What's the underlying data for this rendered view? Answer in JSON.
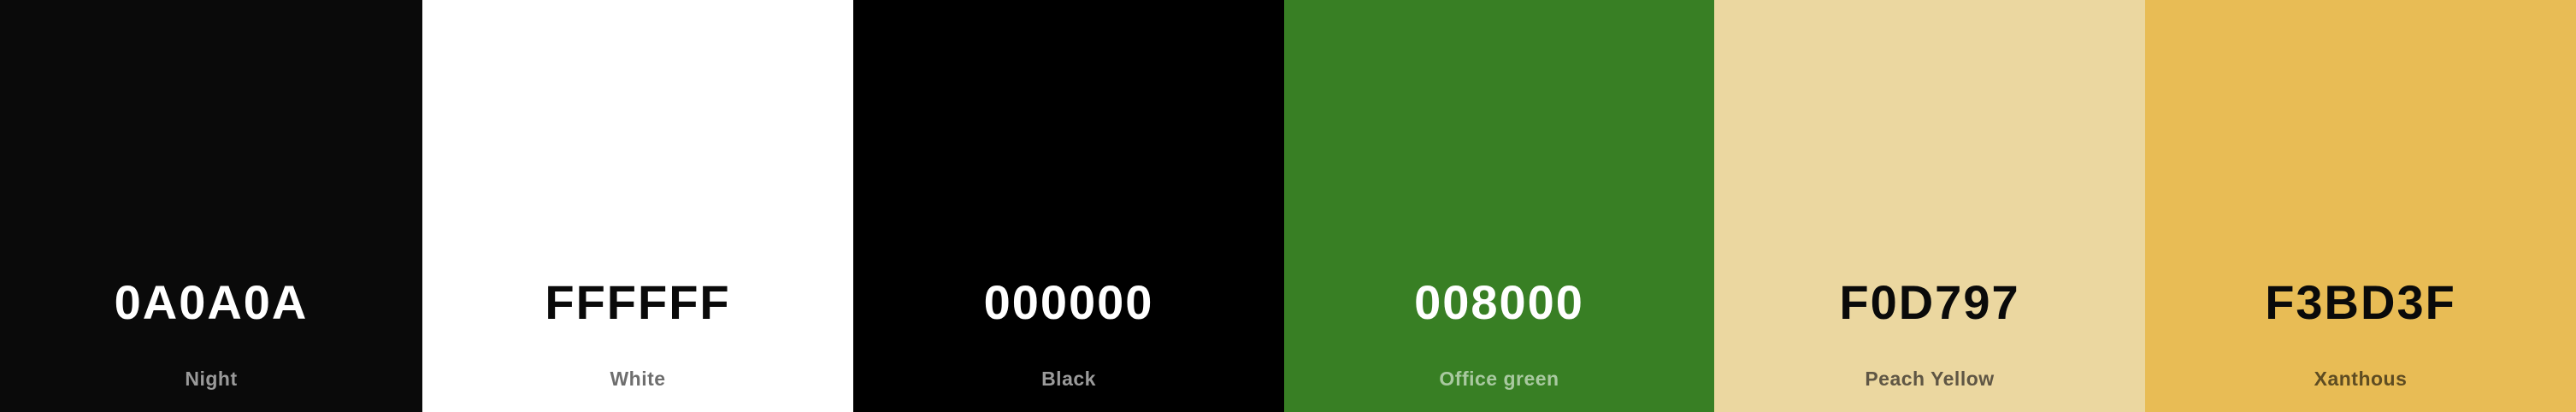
{
  "palette": {
    "swatches": [
      {
        "hex": "0A0A0A",
        "name": "Night",
        "color": "#0A0A0A",
        "text_color": "#FFFFFF",
        "name_color": "#9A9A9A"
      },
      {
        "hex": "FFFFFF",
        "name": "White",
        "color": "#FFFFFF",
        "text_color": "#0A0A0A",
        "name_color": "#6E6E6E"
      },
      {
        "hex": "000000",
        "name": "Black",
        "color": "#000000",
        "text_color": "#FFFFFF",
        "name_color": "#9A9A9A"
      },
      {
        "hex": "008000",
        "name": "Office green",
        "color": "#387F24",
        "text_color": "#FFFFFF",
        "name_color": "#A9C9A0"
      },
      {
        "hex": "F0D797",
        "name": "Peach Yellow",
        "color": "#EBD7A0",
        "text_color": "#0A0A0A",
        "name_color": "#5F5644"
      },
      {
        "hex": "F3BD3F",
        "name": "Xanthous",
        "color": "#E8BC55",
        "text_color": "#0A0A0A",
        "name_color": "#5E4C22"
      }
    ]
  }
}
